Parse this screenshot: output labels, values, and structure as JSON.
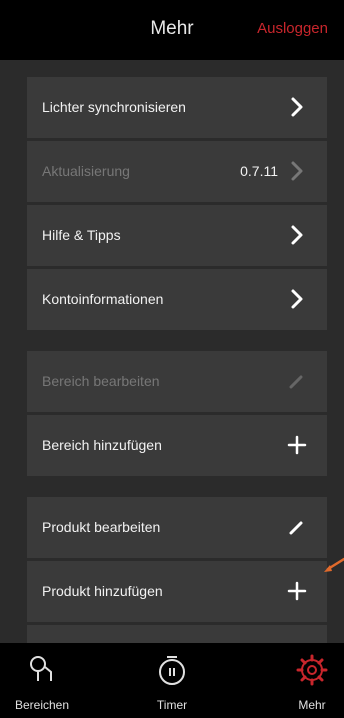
{
  "header": {
    "title": "Mehr",
    "logout_label": "Ausloggen"
  },
  "menu": {
    "items": [
      {
        "label": "Lichter synchronisieren",
        "icon": "chevron-right-icon"
      },
      {
        "label": "Aktualisierung",
        "value": "0.7.11",
        "icon": "chevron-right-icon"
      },
      {
        "label": "Hilfe & Tipps",
        "icon": "chevron-right-icon"
      },
      {
        "label": "Kontoinformationen",
        "icon": "chevron-right-icon"
      },
      {
        "label": "Bereich bearbeiten",
        "icon": "pencil-icon"
      },
      {
        "label": "Bereich hinzufügen",
        "icon": "plus-icon"
      },
      {
        "label": "Produkt bearbeiten",
        "icon": "pencil-icon"
      },
      {
        "label": "Produkt hinzufügen",
        "icon": "plus-icon"
      }
    ]
  },
  "tabs": [
    {
      "label": "Bereichen",
      "icon": "room-icon"
    },
    {
      "label": "Timer",
      "icon": "stopwatch-icon"
    },
    {
      "label": "Mehr",
      "icon": "gear-icon",
      "active": true
    }
  ],
  "colors": {
    "accent": "#c8262c",
    "background": "#2b2b2b",
    "row": "#3a3a3a",
    "bar": "#000000",
    "arrow": "#e06a2c"
  }
}
